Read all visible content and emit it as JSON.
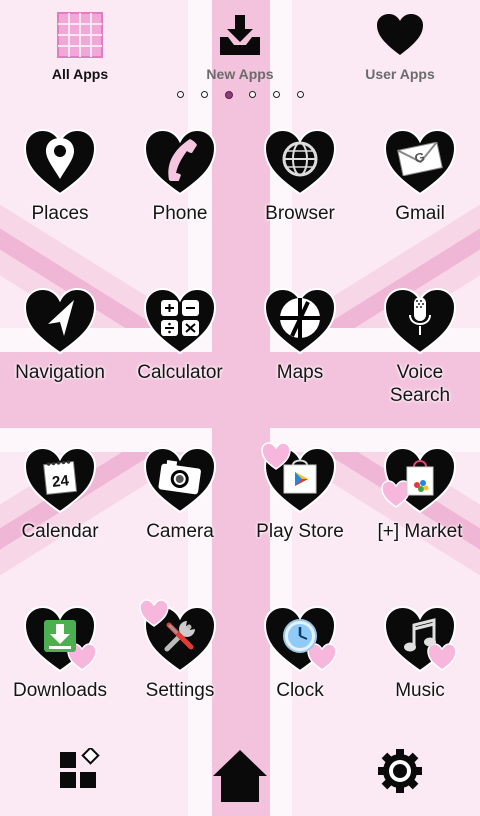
{
  "tabs": [
    {
      "label": "All Apps",
      "icon": "grid-icon",
      "active": true
    },
    {
      "label": "New Apps",
      "icon": "download-tray-icon",
      "active": false
    },
    {
      "label": "User Apps",
      "icon": "heart-icon",
      "active": false
    }
  ],
  "page_indicator": {
    "count": 6,
    "active_index": 2
  },
  "apps": [
    {
      "label": "Places",
      "icon": "map-pin-icon"
    },
    {
      "label": "Phone",
      "icon": "phone-handset-icon"
    },
    {
      "label": "Browser",
      "icon": "globe-icon"
    },
    {
      "label": "Gmail",
      "icon": "mail-envelope-icon"
    },
    {
      "label": "Navigation",
      "icon": "navigation-arrow-icon"
    },
    {
      "label": "Calculator",
      "icon": "calculator-icon"
    },
    {
      "label": "Maps",
      "icon": "map-icon"
    },
    {
      "label": "Voice\nSearch",
      "icon": "microphone-icon"
    },
    {
      "label": "Calendar",
      "icon": "calendar-icon"
    },
    {
      "label": "Camera",
      "icon": "camera-icon"
    },
    {
      "label": "Play Store",
      "icon": "play-store-icon"
    },
    {
      "label": "[+] Market",
      "icon": "shopping-bag-icon"
    },
    {
      "label": "Downloads",
      "icon": "download-icon"
    },
    {
      "label": "Settings",
      "icon": "tools-icon"
    },
    {
      "label": "Clock",
      "icon": "clock-icon"
    },
    {
      "label": "Music",
      "icon": "music-notes-icon"
    }
  ],
  "calendar_day": "24",
  "dock": [
    {
      "icon": "widgets-icon"
    },
    {
      "icon": "home-icon"
    },
    {
      "icon": "settings-gear-icon"
    }
  ],
  "colors": {
    "background": "#fbeaf4",
    "accent_pink": "#f3c3dd",
    "icon_black": "#0a0a0a",
    "active_dot": "#8a3d78"
  }
}
